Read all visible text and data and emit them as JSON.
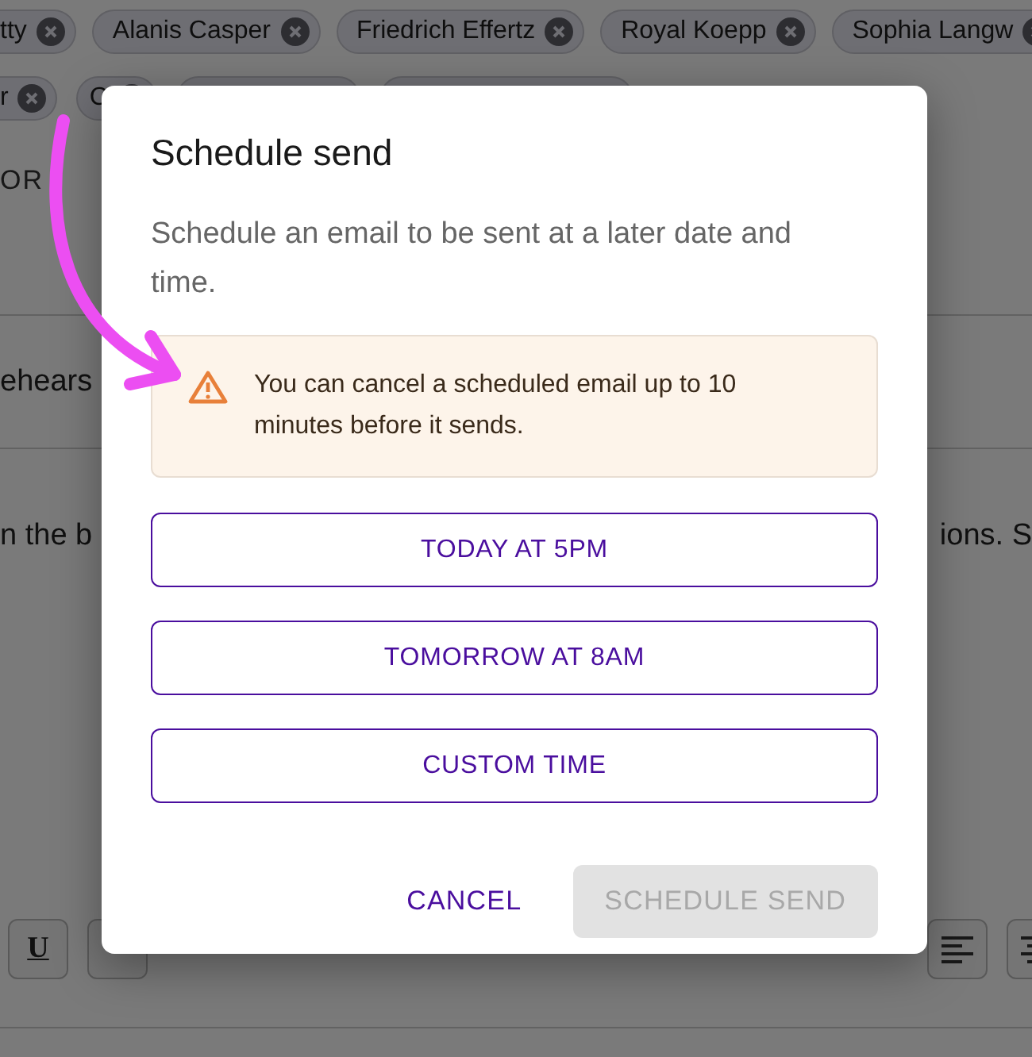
{
  "background": {
    "chip_rows": [
      {
        "chips": [
          {
            "kind": "named",
            "label": "tty"
          },
          {
            "kind": "named",
            "label": "Alanis Casper"
          },
          {
            "kind": "named",
            "label": "Friedrich Effertz"
          },
          {
            "kind": "named",
            "label": "Royal Koepp"
          },
          {
            "kind": "named",
            "label": "Sophia Langw"
          }
        ]
      },
      {
        "chips": [
          {
            "kind": "named",
            "label": "r"
          },
          {
            "kind": "named",
            "label": "C"
          },
          {
            "kind": "covered"
          },
          {
            "kind": "covered"
          }
        ]
      }
    ],
    "section_label": "OR",
    "lines": [
      {
        "left": "ehears"
      },
      {
        "left": "n the b",
        "right": "ions. S"
      }
    ],
    "toolbar": {
      "left": [
        {
          "kind": "text",
          "label": "U"
        },
        {
          "kind": "blank"
        }
      ],
      "right": [
        {
          "kind": "align-left"
        },
        {
          "kind": "align-center"
        }
      ]
    }
  },
  "dialog": {
    "title": "Schedule send",
    "description": "Schedule an email to be sent at a later date and time.",
    "alert": {
      "text": "You can cancel a scheduled email up to 10 minutes before it sends."
    },
    "options": [
      {
        "label": "TODAY AT 5PM"
      },
      {
        "label": "TOMORROW AT 8AM"
      },
      {
        "label": "CUSTOM TIME"
      }
    ],
    "actions": [
      {
        "label": "CANCEL",
        "kind": "text",
        "disabled": false
      },
      {
        "label": "SCHEDULE SEND",
        "kind": "filled",
        "disabled": true
      }
    ]
  }
}
